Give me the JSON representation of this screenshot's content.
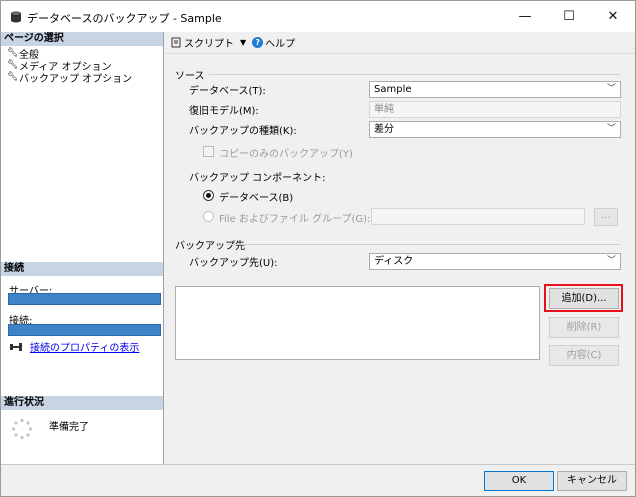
{
  "window": {
    "title": "データベースのバックアップ - Sample",
    "minimize": "—",
    "maximize": "☐",
    "close": "✕"
  },
  "left_panel": {
    "page_select_header": "ページの選択",
    "pages": [
      {
        "label": "全般"
      },
      {
        "label": "メディア オプション"
      },
      {
        "label": "バックアップ オプション"
      }
    ],
    "connection_header": "接続",
    "server_label": "サーバー:",
    "connection_label": "接続:",
    "view_connection_properties": "接続のプロパティの表示",
    "progress_header": "進行状況",
    "progress_status": "準備完了"
  },
  "toolbar": {
    "script_label": "スクリプト",
    "script_dropdown": "▼",
    "help_label": "ヘルプ",
    "help_glyph": "?"
  },
  "main": {
    "source_title": "ソース",
    "database_label": "データベース(T):",
    "database_value": "Sample",
    "recovery_model_label": "復旧モデル(M):",
    "recovery_model_value": "単純",
    "backup_type_label": "バックアップの種類(K):",
    "backup_type_value": "差分",
    "copy_only_label": "コピーのみのバックアップ(Y)",
    "backup_component_label": "バックアップ コンポーネント:",
    "component_database_label": "データベース(B)",
    "component_files_label": "File およびファイル グループ(G):",
    "files_browse_label": "...",
    "destination_title": "バックアップ先",
    "backup_to_label": "バックアップ先(U):",
    "backup_to_value": "ディスク",
    "add_button": "追加(D)...",
    "remove_button": "削除(R)",
    "contents_button": "内容(C)"
  },
  "footer": {
    "ok": "OK",
    "cancel": "キャンセル"
  },
  "colors": {
    "section_header": "#c6d4e3",
    "connection_bar": "#3c83c8",
    "highlight_border": "#e8101a",
    "link": "#0000ee"
  },
  "icons": {
    "title": "database-icon",
    "page_item": "wrench-icon",
    "script": "script-icon",
    "help": "help-icon",
    "connection_properties": "connection-icon",
    "progress": "spinner-icon"
  }
}
